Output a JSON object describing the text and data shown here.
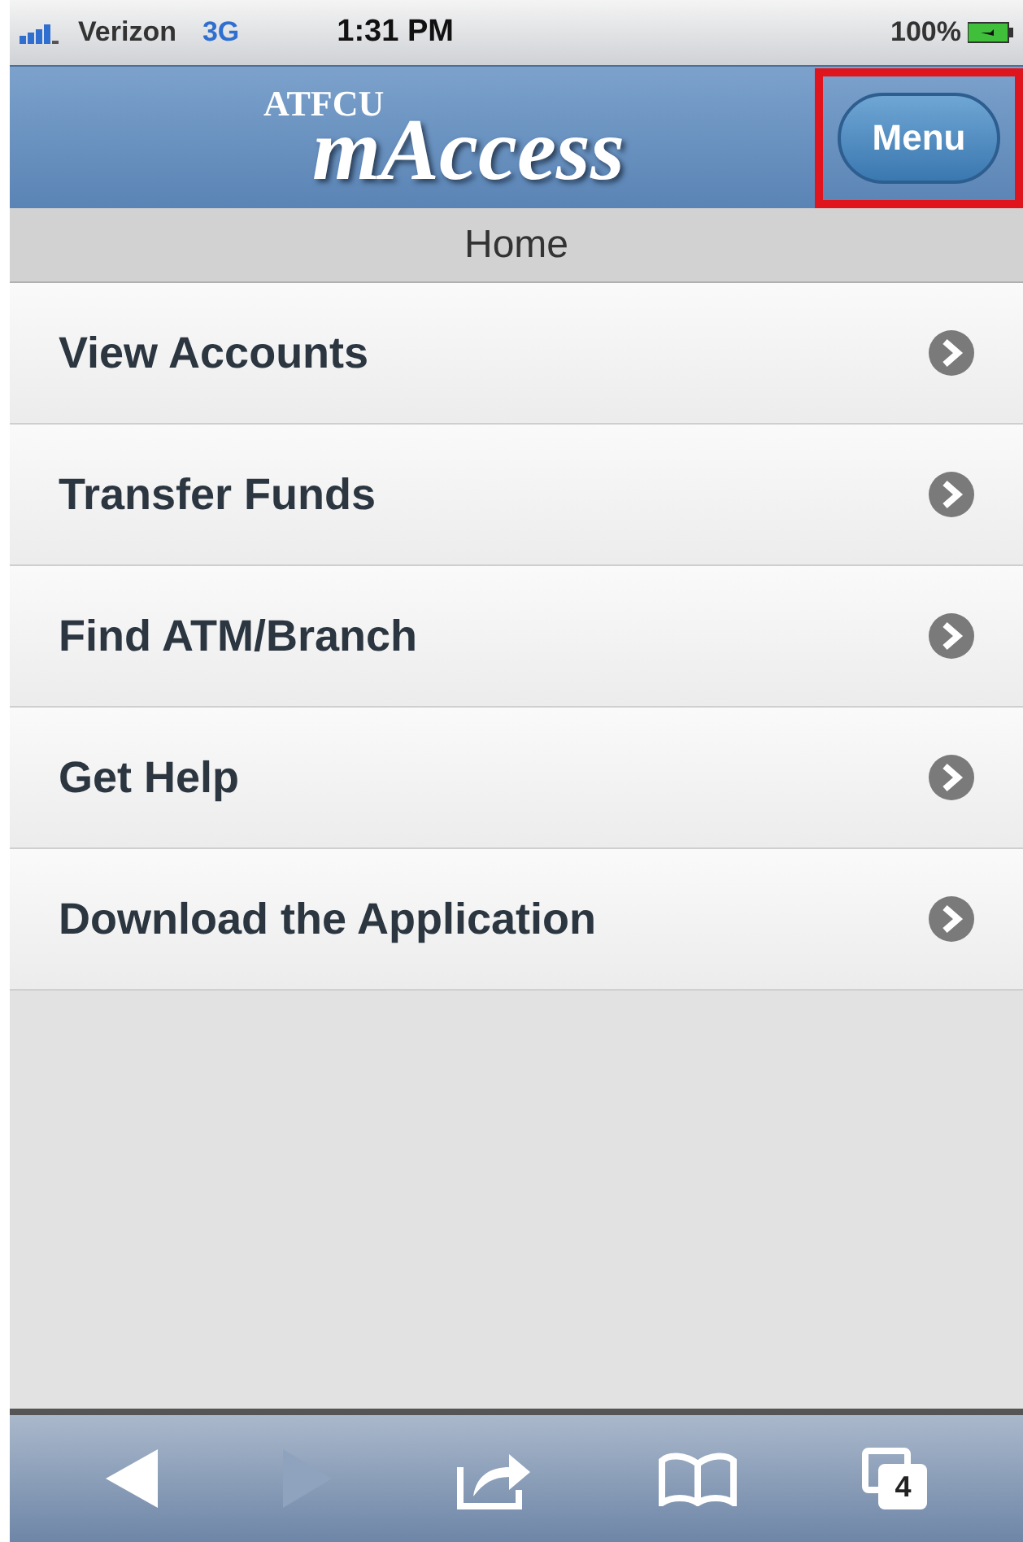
{
  "status_bar": {
    "carrier": "Verizon",
    "network": "3G",
    "time": "1:31 PM",
    "battery": "100%"
  },
  "header": {
    "brand_small": "ATFCU",
    "brand_large": "mAccess",
    "menu_button": {
      "label": "Menu",
      "highlighted": true
    }
  },
  "page_title": "Home",
  "menu_items": [
    {
      "label": "View Accounts"
    },
    {
      "label": "Transfer Funds"
    },
    {
      "label": "Find ATM/Branch"
    },
    {
      "label": "Get Help"
    },
    {
      "label": "Download the Application"
    }
  ],
  "toolbar": {
    "back_disabled": false,
    "forward_disabled": true,
    "tab_count": "4"
  }
}
